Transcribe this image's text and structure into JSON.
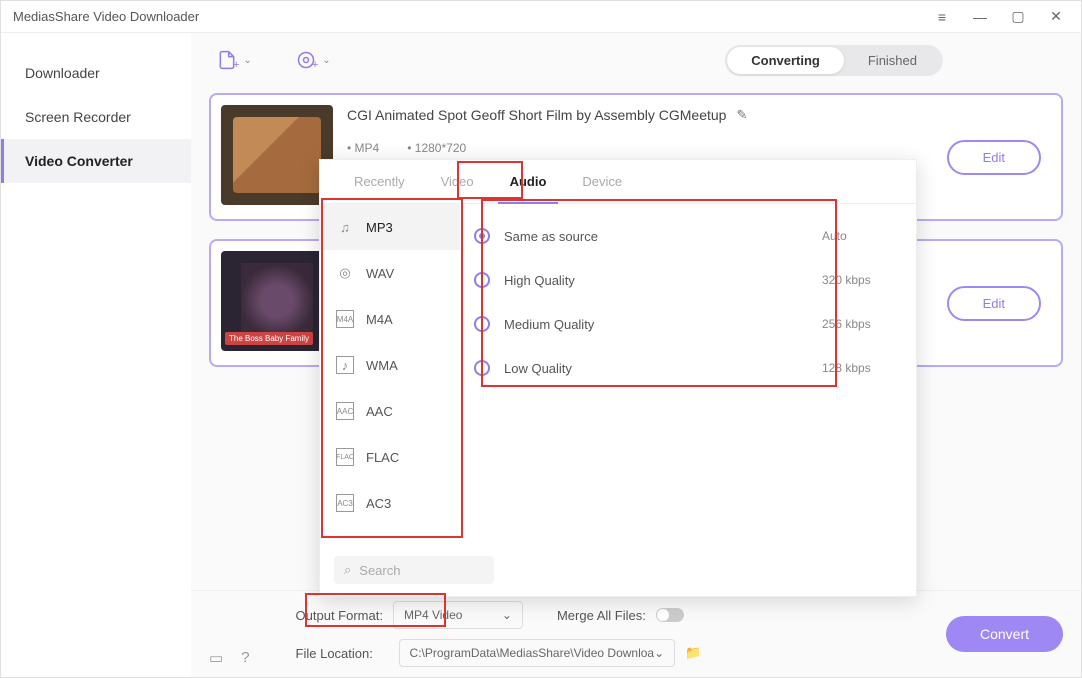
{
  "window_title": "MediasShare Video Downloader",
  "sidebar": {
    "items": [
      {
        "label": "Downloader"
      },
      {
        "label": "Screen Recorder"
      },
      {
        "label": "Video Converter"
      }
    ]
  },
  "tabs": {
    "converting": "Converting",
    "finished": "Finished"
  },
  "cards": [
    {
      "title": "CGI Animated Spot Geoff Short Film by Assembly  CGMeetup",
      "format": "MP4",
      "res": "1280*720",
      "edit": "Edit"
    },
    {
      "title": "",
      "edit": "Edit"
    }
  ],
  "popover": {
    "tabs": {
      "recently": "Recently",
      "video": "Video",
      "audio": "Audio",
      "device": "Device"
    },
    "formats": [
      "MP3",
      "WAV",
      "M4A",
      "WMA",
      "AAC",
      "FLAC",
      "AC3"
    ],
    "qualities": [
      {
        "label": "Same as source",
        "val": "Auto"
      },
      {
        "label": "High Quality",
        "val": "320 kbps"
      },
      {
        "label": "Medium Quality",
        "val": "256 kbps"
      },
      {
        "label": "Low Quality",
        "val": "128 kbps"
      }
    ],
    "search_placeholder": "Search"
  },
  "bottom": {
    "output_label": "Output Format:",
    "output_value": "MP4 Video",
    "merge_label": "Merge All Files:",
    "location_label": "File Location:",
    "location_value": "C:\\ProgramData\\MediasShare\\Video Downloa",
    "convert": "Convert"
  }
}
